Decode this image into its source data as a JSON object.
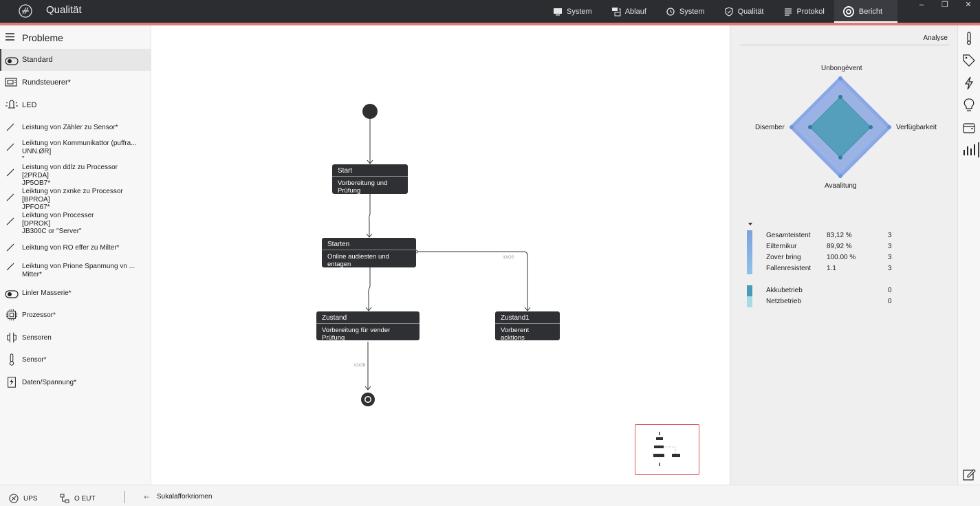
{
  "app": {
    "title": "Qualität"
  },
  "nav": [
    {
      "label": "System",
      "icon": "monitor-icon"
    },
    {
      "label": "Ablauf",
      "icon": "flow-icon"
    },
    {
      "label": "System",
      "icon": "history-icon"
    },
    {
      "label": "Qualität",
      "icon": "shield-check-icon"
    },
    {
      "label": "Protokol",
      "icon": "list-icon"
    },
    {
      "label": "Bericht",
      "icon": "gear-icon",
      "active": true
    }
  ],
  "window_controls": {
    "minimize": "–",
    "restore": "❐",
    "close": "✕"
  },
  "sidebar": {
    "title": "Probleme",
    "items": [
      {
        "label": "Standard",
        "icon": "toggle-icon",
        "active": true
      },
      {
        "label": "Rundsteuerer*",
        "icon": "controller-icon"
      },
      {
        "label": "LED",
        "icon": "led-icon"
      },
      {
        "label": "Leistung von Zähler zu Sensor*",
        "icon": "line-icon"
      },
      {
        "label": "Leiktung von Kommunikattor (puffra...\nUNN.ØR]\n\"",
        "icon": "line-icon"
      },
      {
        "label": "Leistung von ddlz zu Processor\n[2PRDA]\nJP5OB7*",
        "icon": "line-icon"
      },
      {
        "label": "Leiktung von zxnke zu Processor\n[BPROA]\nJPFO67*",
        "icon": "line-icon"
      },
      {
        "label": "Leiktung von Processer\n[DPROK]\nJB300C or \"Server\"",
        "icon": "line-icon"
      },
      {
        "label": "Leiktung von RO effer zu Milter*",
        "icon": "line-icon"
      },
      {
        "label": "Leiktung von Prione Spanmung vn ...\nMitter*",
        "icon": "line-icon"
      },
      {
        "label": "Linler Masserie*",
        "icon": "toggle-icon"
      },
      {
        "label": "Prozessor*",
        "icon": "chip-icon"
      },
      {
        "label": "Sensoren",
        "icon": "sensors-icon"
      },
      {
        "label": "Sensor*",
        "icon": "thermometer-icon"
      },
      {
        "label": "Daten/Spannung*",
        "icon": "data-icon"
      }
    ]
  },
  "diagram": {
    "nodes": [
      {
        "title": "Start",
        "body": "Vorbereitung und Prüfung"
      },
      {
        "title": "Starten",
        "body": "Online audiesten und entagen"
      },
      {
        "title": "Zustand",
        "body": "Vorbereitung für vender Prüfung"
      },
      {
        "title": "Zustand1",
        "body": "Vorberent acktions"
      }
    ],
    "edge_labels": [
      "IOIOS",
      "IOIOB"
    ]
  },
  "right_panel": {
    "tab": "Analyse",
    "radar": {
      "axes": [
        "Unbongévent",
        "Verfügbarkeit",
        "Avaalitung",
        "Disember"
      ],
      "series": [
        {
          "values": [
            1.0,
            1.0,
            1.0,
            1.0
          ],
          "color": "#7f9ee0"
        },
        {
          "values": [
            0.62,
            0.62,
            0.62,
            0.62
          ],
          "color": "#4a9bb5"
        }
      ]
    },
    "legend_rows": [
      {
        "name": "Gesamteistent",
        "percent": "83,12 %",
        "count": "3"
      },
      {
        "name": "Eilternikur",
        "percent": "89,92 %",
        "count": "3"
      },
      {
        "name": "Zover bring",
        "percent": "100.00 %",
        "count": "3"
      },
      {
        "name": "Fallenresistent",
        "percent": "1.1",
        "count": "3"
      }
    ],
    "legend_rows2": [
      {
        "name": "Akkubetrieb",
        "count": "0",
        "color": "#4a9bb5"
      },
      {
        "name": "Netzbetrieb",
        "count": "0",
        "color": "#a9dbe4"
      }
    ],
    "legend_color": "#7f9ee0"
  },
  "rail_icons": [
    "thermometer-icon",
    "tag-icon",
    "bolt-icon",
    "bulb-icon",
    "wallet-icon",
    "bar-chart-icon",
    "edit-icon"
  ],
  "status": {
    "ups": "UPS",
    "eut": "O EUT",
    "extra": "Sukalafforkriomen"
  }
}
